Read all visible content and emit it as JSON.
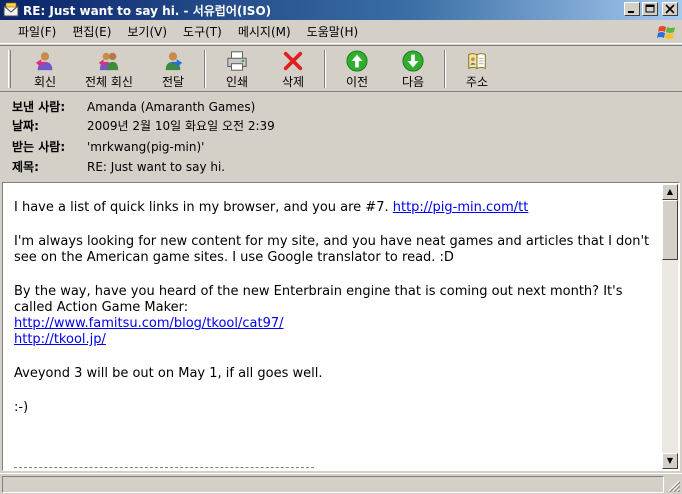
{
  "window": {
    "title": "RE: Just want to say hi. - 서유럽어(ISO)",
    "buttons": {
      "minimize": "_",
      "maximize": "□",
      "close": "×"
    }
  },
  "menu": [
    "파일(F)",
    "편집(E)",
    "보기(V)",
    "도구(T)",
    "메시지(M)",
    "도움말(H)"
  ],
  "toolbar": {
    "reply": "회신",
    "reply_all": "전체 회신",
    "forward": "전달",
    "print": "인쇄",
    "delete": "삭제",
    "previous": "이전",
    "next": "다음",
    "addresses": "주소"
  },
  "headers": {
    "from_label": "보낸 사람:",
    "from_value": "Amanda (Amaranth Games)",
    "date_label": "날짜:",
    "date_value": "2009년 2월 10일 화요일 오전 2:39",
    "to_label": "받는 사람:",
    "to_value": "'mrkwang(pig-min)'",
    "subject_label": "제목:",
    "subject_value": "RE: Just want to say hi."
  },
  "body": {
    "p1_text": "I have a list of quick links in my browser, and you are #7. ",
    "p1_link": "http://pig-min.com/tt",
    "p2_text": "I'm always looking for new content for my site, and you have neat games and articles that I don't see on the American game sites. I use Google translator to read. :D",
    "p3_text": "By the way, have you heard of the new Enterbrain engine that is coming out next month? It's called Action Game Maker:",
    "p3_link1": "http://www.famitsu.com/blog/tkool/cat97/",
    "p3_link2": "http://tkool.jp/",
    "p4_text": "Aveyond 3 will be out on May 1, if all goes well.",
    "p5_text": ":-)"
  },
  "scrollbar": {
    "up": "▲",
    "down": "▼"
  },
  "icons": {
    "app": "envelope-icon",
    "reply": "reply-icon",
    "reply_all": "reply-all-icon",
    "forward": "forward-icon",
    "print": "printer-icon",
    "delete": "delete-x-icon",
    "previous": "up-arrow-icon",
    "next": "down-arrow-icon",
    "addresses": "address-book-icon",
    "windows": "windows-logo-icon"
  },
  "colors": {
    "title_gradient_start": "#0a246a",
    "title_gradient_end": "#a6caf0",
    "link": "#0000ee",
    "delete_red": "#e02020",
    "nav_green": "#2fae2f"
  }
}
